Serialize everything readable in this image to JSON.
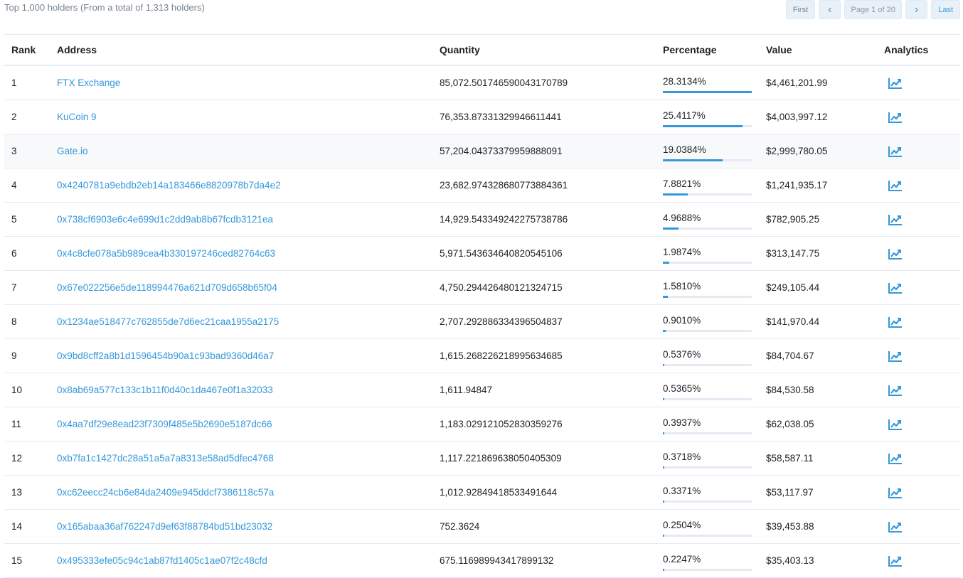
{
  "summary": "Top 1,000 holders (From a total of 1,313 holders)",
  "pagination": {
    "first": "First",
    "prev": "‹",
    "page": "Page 1 of 20",
    "next": "›",
    "last": "Last"
  },
  "columns": {
    "rank": "Rank",
    "address": "Address",
    "quantity": "Quantity",
    "percentage": "Percentage",
    "value": "Value",
    "analytics": "Analytics"
  },
  "accent_color": "#3498db",
  "analytics_icon": "chart-line-icon",
  "rows": [
    {
      "rank": "1",
      "address": "FTX Exchange",
      "quantity": "85,072.501746590043170789",
      "percentage": "28.3134%",
      "pct_value": 28.3134,
      "value": "$4,461,201.99"
    },
    {
      "rank": "2",
      "address": "KuCoin 9",
      "quantity": "76,353.87331329946611441",
      "percentage": "25.4117%",
      "pct_value": 25.4117,
      "value": "$4,003,997.12"
    },
    {
      "rank": "3",
      "address": "Gate.io",
      "quantity": "57,204.04373379959888091",
      "percentage": "19.0384%",
      "pct_value": 19.0384,
      "value": "$2,999,780.05",
      "highlight": true
    },
    {
      "rank": "4",
      "address": "0x4240781a9ebdb2eb14a183466e8820978b7da4e2",
      "quantity": "23,682.974328680773884361",
      "percentage": "7.8821%",
      "pct_value": 7.8821,
      "value": "$1,241,935.17"
    },
    {
      "rank": "5",
      "address": "0x738cf6903e6c4e699d1c2dd9ab8b67fcdb3121ea",
      "quantity": "14,929.543349242275738786",
      "percentage": "4.9688%",
      "pct_value": 4.9688,
      "value": "$782,905.25"
    },
    {
      "rank": "6",
      "address": "0x4c8cfe078a5b989cea4b330197246ced82764c63",
      "quantity": "5,971.543634640820545106",
      "percentage": "1.9874%",
      "pct_value": 1.9874,
      "value": "$313,147.75"
    },
    {
      "rank": "7",
      "address": "0x67e022256e5de118994476a621d709d658b65f04",
      "quantity": "4,750.294426480121324715",
      "percentage": "1.5810%",
      "pct_value": 1.581,
      "value": "$249,105.44"
    },
    {
      "rank": "8",
      "address": "0x1234ae518477c762855de7d6ec21caa1955a2175",
      "quantity": "2,707.292886334396504837",
      "percentage": "0.9010%",
      "pct_value": 0.901,
      "value": "$141,970.44"
    },
    {
      "rank": "9",
      "address": "0x9bd8cff2a8b1d1596454b90a1c93bad9360d46a7",
      "quantity": "1,615.268226218995634685",
      "percentage": "0.5376%",
      "pct_value": 0.5376,
      "value": "$84,704.67"
    },
    {
      "rank": "10",
      "address": "0x8ab69a577c133c1b11f0d40c1da467e0f1a32033",
      "quantity": "1,611.94847",
      "percentage": "0.5365%",
      "pct_value": 0.5365,
      "value": "$84,530.58"
    },
    {
      "rank": "11",
      "address": "0x4aa7df29e8ead23f7309f485e5b2690e5187dc66",
      "quantity": "1,183.029121052830359276",
      "percentage": "0.3937%",
      "pct_value": 0.3937,
      "value": "$62,038.05"
    },
    {
      "rank": "12",
      "address": "0xb7fa1c1427dc28a51a5a7a8313e58ad5dfec4768",
      "quantity": "1,117.221869638050405309",
      "percentage": "0.3718%",
      "pct_value": 0.3718,
      "value": "$58,587.11"
    },
    {
      "rank": "13",
      "address": "0xc62eecc24cb6e84da2409e945ddcf7386118c57a",
      "quantity": "1,012.92849418533491644",
      "percentage": "0.3371%",
      "pct_value": 0.3371,
      "value": "$53,117.97"
    },
    {
      "rank": "14",
      "address": "0x165abaa36af762247d9ef63f88784bd51bd23032",
      "quantity": "752.3624",
      "percentage": "0.2504%",
      "pct_value": 0.2504,
      "value": "$39,453.88"
    },
    {
      "rank": "15",
      "address": "0x495333efe05c94c1ab87fd1405c1ae07f2c48cfd",
      "quantity": "675.116989943417899132",
      "percentage": "0.2247%",
      "pct_value": 0.2247,
      "value": "$35,403.13"
    }
  ]
}
